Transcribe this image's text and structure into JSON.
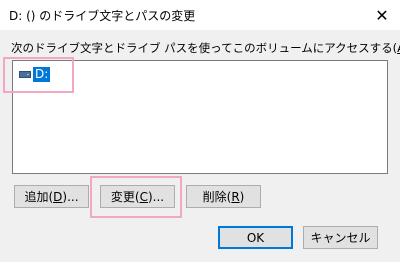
{
  "window": {
    "title": "D: () のドライブ文字とパスの変更",
    "close_glyph": "✕"
  },
  "instruction": {
    "text_before": "次のドライブ文字とドライブ パスを使ってこのボリュームにアクセスする(",
    "mnemonic": "A",
    "text_after": "):"
  },
  "list": {
    "items": [
      {
        "label": "D:",
        "icon": "drive-icon",
        "selected": true
      }
    ]
  },
  "buttons": {
    "add": {
      "before": "追加(",
      "mnemonic": "D",
      "after": ")..."
    },
    "change": {
      "before": "変更(",
      "mnemonic": "C",
      "after": ")..."
    },
    "remove": {
      "before": "削除(",
      "mnemonic": "R",
      "after": ")"
    },
    "ok": {
      "label": "OK"
    },
    "cancel": {
      "label": "キャンセル"
    }
  },
  "highlight_color": "#f1a7c6",
  "selection_color": "#0078d7"
}
